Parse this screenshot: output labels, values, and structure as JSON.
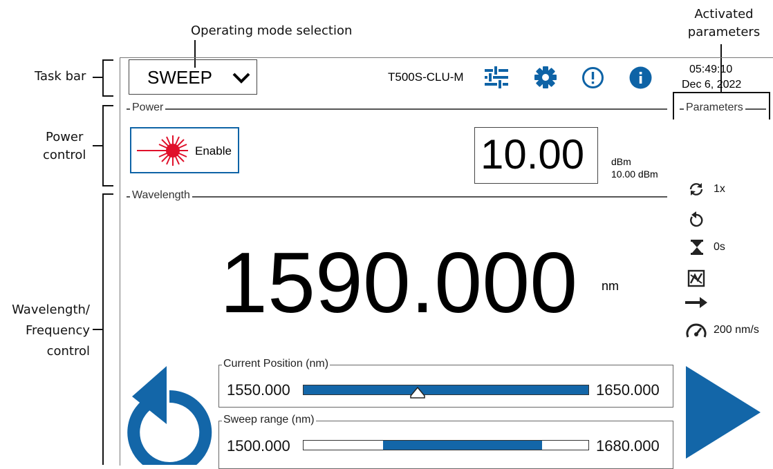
{
  "annotations": {
    "operating_mode": "Operating mode selection",
    "activated_params_1": "Activated",
    "activated_params_2": "parameters",
    "task_bar": "Task bar",
    "power_control_1": "Power",
    "power_control_2": "control",
    "wl_control_1": "Wavelength/",
    "wl_control_2": "Frequency",
    "wl_control_3": "control"
  },
  "taskbar": {
    "mode": "SWEEP",
    "model": "T500S-CLU-M",
    "time": "05:49:10",
    "date": "Dec 6, 2022"
  },
  "power": {
    "section": "Power",
    "enable_label": "Enable",
    "value": "10.00",
    "unit": "dBm",
    "actual": "10.00 dBm"
  },
  "parameters": {
    "section": "Parameters",
    "cycles": "1x",
    "dwell": "0s",
    "speed": "200 nm/s"
  },
  "wavelength": {
    "section": "Wavelength",
    "value": "1590.000",
    "unit": "nm"
  },
  "current_position": {
    "title": "Current Position  (nm)",
    "min": "1550.000",
    "max": "1650.000",
    "marker_fraction": 0.4
  },
  "sweep_range": {
    "title": "Sweep range (nm)",
    "min": "1500.000",
    "max": "1680.000",
    "start_fraction": 0.278,
    "end_fraction": 0.833
  },
  "colors": {
    "accent": "#0e63a6",
    "laser": "#e0102a"
  },
  "icons": [
    "chevron-down-icon",
    "sliders-icon",
    "gear-icon",
    "alert-icon",
    "info-icon",
    "laser-icon",
    "repeat-icon",
    "undo-icon",
    "hourglass-icon",
    "pattern-icon",
    "arrow-right-icon",
    "speedometer-icon",
    "reset-icon",
    "play-icon"
  ]
}
